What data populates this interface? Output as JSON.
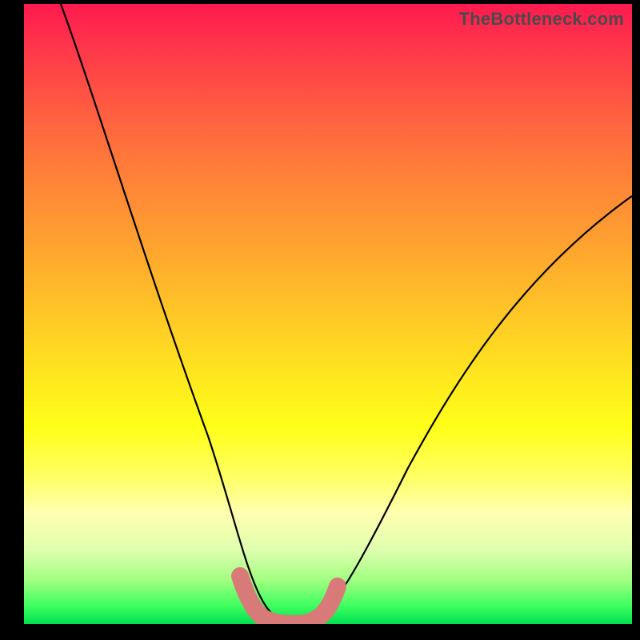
{
  "watermark": "TheBottleneck.com",
  "chart_data": {
    "type": "line",
    "title": "",
    "xlabel": "",
    "ylabel": "",
    "xlim": [
      0,
      100
    ],
    "ylim": [
      0,
      100
    ],
    "series": [
      {
        "name": "bottleneck-curve",
        "x": [
          6,
          10,
          14,
          18,
          22,
          26,
          30,
          33,
          35,
          37,
          39,
          41,
          43,
          45,
          47,
          50,
          55,
          62,
          70,
          78,
          86,
          94,
          100
        ],
        "values": [
          100,
          88,
          76,
          64,
          53,
          42,
          32,
          22,
          15,
          9,
          5,
          2,
          1,
          1,
          1,
          2,
          6,
          14,
          24,
          36,
          48,
          60,
          69
        ]
      },
      {
        "name": "highlight-band",
        "x": [
          35,
          37,
          39,
          41,
          43,
          45,
          47,
          49
        ],
        "values": [
          8,
          4,
          2,
          1,
          1,
          1,
          2,
          4
        ]
      }
    ],
    "colors": {
      "curve": "#000000",
      "highlight": "#d87a78",
      "gradient_top": "#ff1a4f",
      "gradient_mid": "#ffff18",
      "gradient_bottom": "#00e050"
    }
  }
}
